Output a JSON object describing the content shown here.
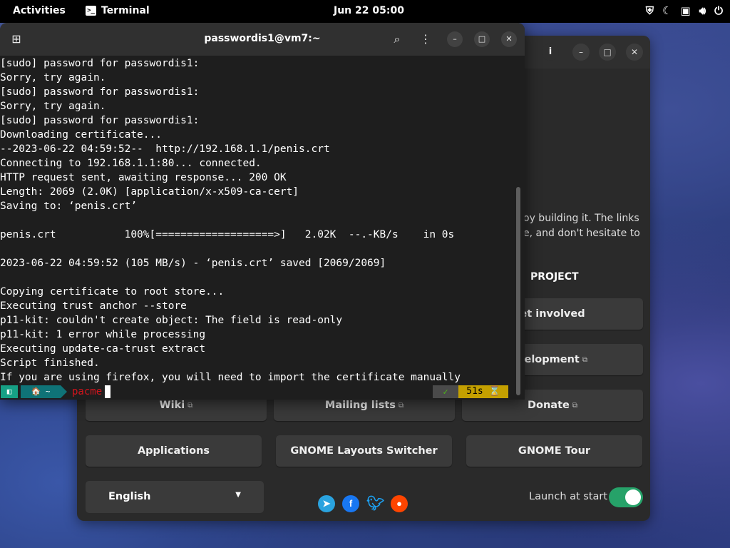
{
  "topbar": {
    "activities": "Activities",
    "app_name": "Terminal",
    "clock": "Jun 22  05:00",
    "tray_icons": [
      "shield-icon",
      "moon-icon",
      "screen-icon",
      "volume-icon",
      "power-icon"
    ]
  },
  "terminal": {
    "title": "passwordis1@vm7:~",
    "lines": [
      "[sudo] password for passwordis1:",
      "Sorry, try again.",
      "[sudo] password for passwordis1:",
      "Sorry, try again.",
      "[sudo] password for passwordis1:",
      "Downloading certificate...",
      "--2023-06-22 04:59:52--  http://192.168.1.1/penis.crt",
      "Connecting to 192.168.1.1:80... connected.",
      "HTTP request sent, awaiting response... 200 OK",
      "Length: 2069 (2.0K) [application/x-x509-ca-cert]",
      "Saving to: ‘penis.crt’",
      "",
      "penis.crt           100%[===================>]   2.02K  --.-KB/s    in 0s",
      "",
      "2023-06-22 04:59:52 (105 MB/s) - ‘penis.crt’ saved [2069/2069]",
      "",
      "Copying certificate to root store...",
      "Executing trust anchor --store",
      "p11-kit: couldn't create object: The field is read-only",
      "p11-kit: 1 error while processing",
      "Executing update-ca-trust extract",
      "Script finished.",
      "If you are using firefox, you will need to import the certificate manually"
    ],
    "prompt": {
      "path": "🏠 ~",
      "command": "pacme",
      "status": "✓",
      "duration": "51s ⌛"
    }
  },
  "welcome": {
    "intro_lines": [
      "oy building it. The links",
      "e, and don't hesitate to"
    ],
    "section_title": "PROJECT",
    "buttons": {
      "get_involved": "et involved",
      "development": "velopment",
      "wiki": "Wiki",
      "mailing_lists": "Mailing lists",
      "donate": "Donate",
      "applications": "Applications",
      "layouts_switcher": "GNOME Layouts Switcher",
      "tour": "GNOME Tour"
    },
    "language": "English",
    "launch_at_start": "Launch at start",
    "launch_enabled": true
  },
  "colors": {
    "toggle_on": "#26a269",
    "prompt_teal": "#16a085",
    "prompt_dark_teal": "#0f7377",
    "duration_bg": "#c4a000",
    "command_red": "#d2141c"
  }
}
